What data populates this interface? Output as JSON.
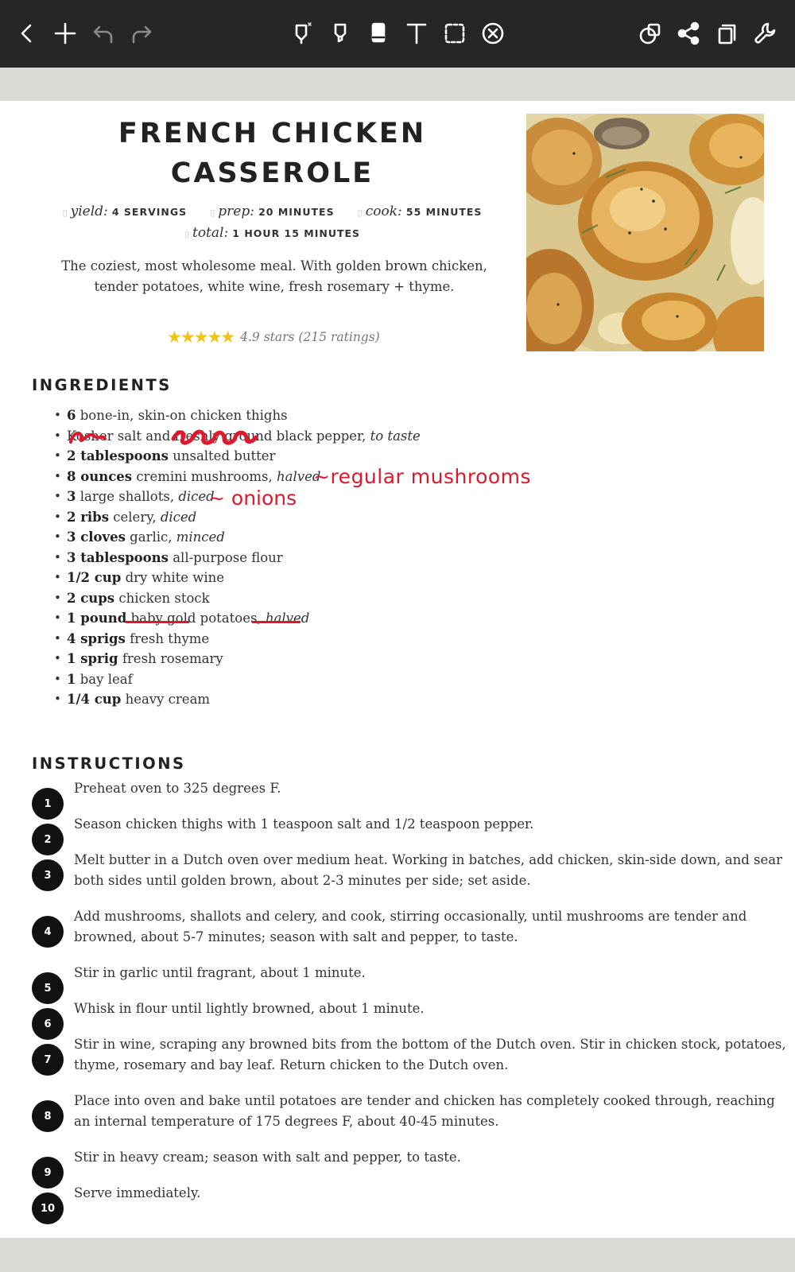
{
  "toolbar": {
    "icons": [
      "back-icon",
      "add-icon",
      "undo-icon",
      "redo-icon",
      "pen-icon",
      "highlighter-icon",
      "eraser-icon",
      "text-icon",
      "lasso-select-icon",
      "shape-delete-icon",
      "shapes-icon",
      "share-icon",
      "copy-icon",
      "settings-icon"
    ],
    "colors": {
      "background": "#262626",
      "icon": "#ffffff",
      "icon_disabled": "#8a8a8a"
    }
  },
  "recipe": {
    "title_line1": "FRENCH CHICKEN",
    "title_line2": "CASSEROLE",
    "meta": {
      "yield_label": "yield:",
      "yield_value": "4 servings",
      "prep_label": "prep:",
      "prep_value": "20 minutes",
      "cook_label": "cook:",
      "cook_value": "55 minutes",
      "total_label": "total:",
      "total_value": "1 hour 15 minutes"
    },
    "summary": "The coziest, most wholesome meal. With golden brown chicken, tender potatoes, white wine, fresh rosemary + thyme.",
    "rating": {
      "stars": "★★★★★",
      "text": "4.9 stars (215 ratings)"
    },
    "ingredients_heading": "INGREDIENTS",
    "ingredients": [
      {
        "amount": "6",
        "item": "bone-in, skin-on chicken thighs",
        "note": ""
      },
      {
        "amount": "",
        "item": "Kosher salt and freshly ground black pepper,",
        "note": "to taste"
      },
      {
        "amount": "2 tablespoons",
        "item": "unsalted butter",
        "note": ""
      },
      {
        "amount": "8 ounces",
        "item": "cremini mushrooms,",
        "note": "halved"
      },
      {
        "amount": "3",
        "item": "large shallots,",
        "note": "diced"
      },
      {
        "amount": "2 ribs",
        "item": "celery,",
        "note": "diced"
      },
      {
        "amount": "3 cloves",
        "item": "garlic,",
        "note": "minced"
      },
      {
        "amount": "3 tablespoons",
        "item": "all-purpose flour",
        "note": ""
      },
      {
        "amount": "1/2 cup",
        "item": "dry white wine",
        "note": ""
      },
      {
        "amount": "2 cups",
        "item": "chicken stock",
        "note": ""
      },
      {
        "amount": "1 pound",
        "item": "baby gold potatoes,",
        "note": "halved"
      },
      {
        "amount": "4 sprigs",
        "item": "fresh thyme",
        "note": ""
      },
      {
        "amount": "1 sprig",
        "item": "fresh rosemary",
        "note": ""
      },
      {
        "amount": "1",
        "item": "bay leaf",
        "note": ""
      },
      {
        "amount": "1/4 cup",
        "item": "heavy cream",
        "note": ""
      }
    ],
    "annotations": {
      "mushrooms": "regular mushrooms",
      "shallots": "onions",
      "color": "#e0182b"
    },
    "instructions_heading": "INSTRUCTIONS",
    "instructions": [
      {
        "n": "1",
        "text": "Preheat oven to 325 degrees F."
      },
      {
        "n": "2",
        "text": "Season chicken thighs with 1 teaspoon salt and 1/2 teaspoon pepper."
      },
      {
        "n": "3",
        "text": "Melt butter in a Dutch oven over medium heat. Working in batches, add chicken, skin-side down, and sear both sides until golden brown, about 2-3 minutes per side; set aside."
      },
      {
        "n": "4",
        "text": "Add mushrooms, shallots and celery, and cook, stirring occasionally, until mushrooms are tender and browned, about 5-7 minutes; season with salt and pepper, to taste."
      },
      {
        "n": "5",
        "text": "Stir in garlic until fragrant, about 1 minute."
      },
      {
        "n": "6",
        "text": "Whisk in flour until lightly browned, about 1 minute."
      },
      {
        "n": "7",
        "text": "Stir in wine, scraping any browned bits from the bottom of the Dutch oven. Stir in chicken stock, potatoes, thyme, rosemary and bay leaf. Return chicken to the Dutch oven."
      },
      {
        "n": "8",
        "text": "Place into oven and bake until potatoes are tender and chicken has completely cooked through, reaching an internal temperature of 175 degrees F, about 40-45 minutes."
      },
      {
        "n": "9",
        "text": "Stir in heavy cream; season with salt and pepper, to taste."
      },
      {
        "n": "10",
        "text": "Serve immediately."
      }
    ]
  }
}
